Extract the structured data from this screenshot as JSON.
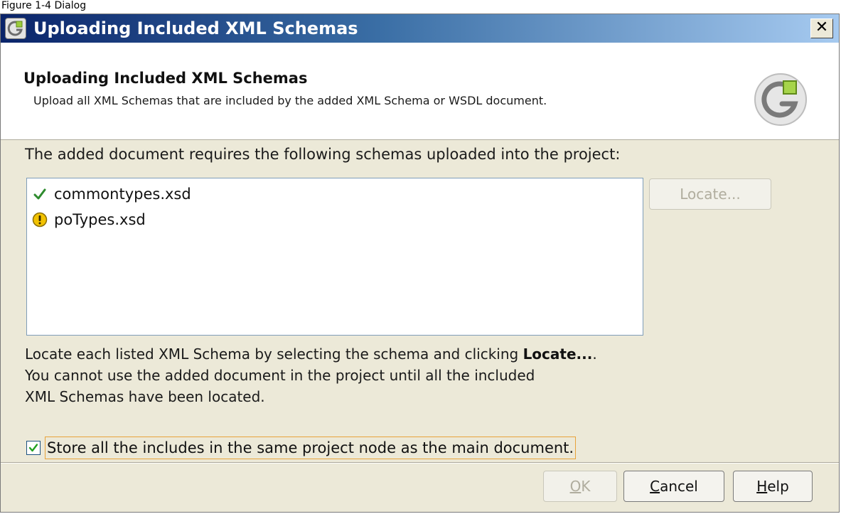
{
  "caption": "Figure 1-4 Dialog",
  "window": {
    "title": "Uploading Included XML Schemas",
    "close_label": "✕"
  },
  "banner": {
    "title": "Uploading Included XML Schemas",
    "subtitle": "Upload all XML Schemas that are included by the added XML Schema or WSDL document."
  },
  "prompt": "The added document requires the following schemas uploaded into the project:",
  "schemas": [
    {
      "name": "commontypes.xsd",
      "status": "located",
      "icon": "checkmark-icon"
    },
    {
      "name": "poTypes.xsd",
      "status": "missing",
      "icon": "warning-icon"
    }
  ],
  "locate_button": "Locate...",
  "help_text": {
    "line1_prefix": "Locate each listed XML Schema by selecting the schema and clicking ",
    "line1_bold": "Locate...",
    "line1_suffix": ".",
    "line2": "You cannot use the added document in the project until all the included",
    "line3": "XML Schemas have been located."
  },
  "store_option": {
    "label": "Store all the includes in the same project node as the main document.",
    "checked": true
  },
  "buttons": {
    "ok_mnemonic": "O",
    "ok_rest": "K",
    "cancel_mnemonic": "C",
    "cancel_rest": "ancel",
    "help_mnemonic": "H",
    "help_rest": "elp"
  },
  "colors": {
    "titlebar_start": "#0a246a",
    "titlebar_end": "#a6caf0",
    "dialog_bg": "#ece9d8",
    "check_green": "#2e8b2e",
    "warning_yellow": "#f2c200",
    "focus_orange": "#e8a33a"
  }
}
